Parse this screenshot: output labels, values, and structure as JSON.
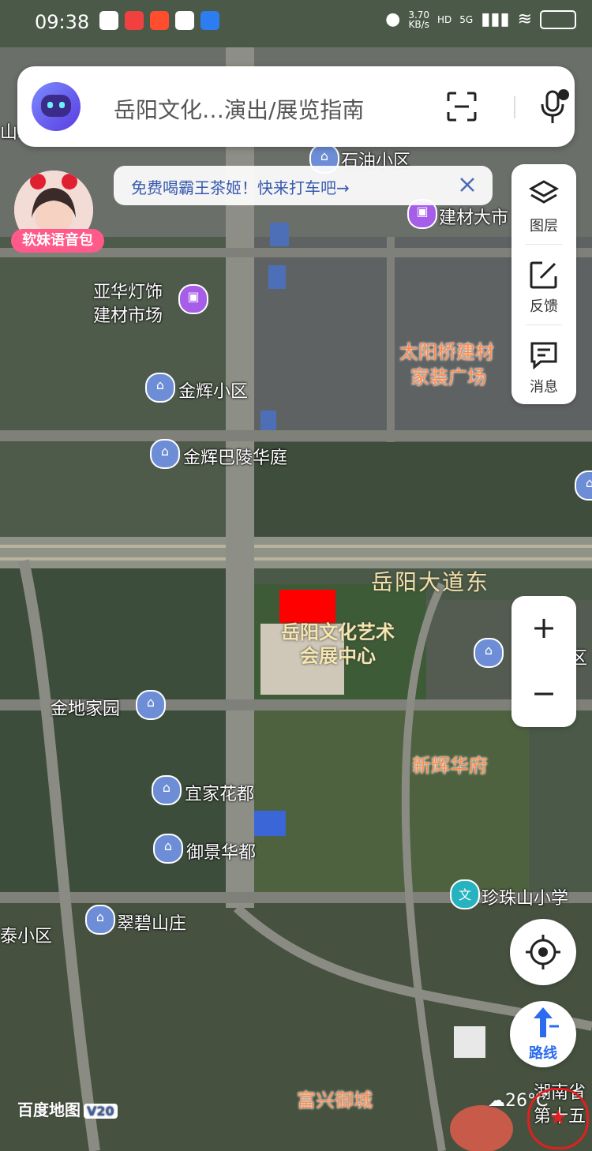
{
  "status_bar": {
    "time": "09:38",
    "network_speed_value": "3.70",
    "network_speed_unit": "KB/s",
    "hd_label": "HD",
    "signal_label": "5G"
  },
  "search": {
    "query_text": "岳阳文化…演出/展览指南"
  },
  "promo": {
    "text": "免费喝霸王茶姬！快来打车吧→"
  },
  "voice_pack": {
    "label": "软妹语音包"
  },
  "side_panel": {
    "layers_label": "图层",
    "feedback_label": "反馈",
    "messages_label": "消息"
  },
  "zoom": {
    "in_label": "+",
    "out_label": "−"
  },
  "route": {
    "label": "路线"
  },
  "map_labels": {
    "shiyou": "石油小区",
    "jiancai_top": "建材大市",
    "yahua_1": "亚华灯饰",
    "yahua_2": "建材市场",
    "taiyangqiao_1": "太阳桥建材",
    "taiyangqiao_2": "家装广场",
    "jinhui": "金辉小区",
    "jinhui_baling": "金辉巴陵华庭",
    "road_main": "岳阳大道东",
    "venue_1": "岳阳文化艺术",
    "venue_2": "会展中心",
    "jindi": "金地家园",
    "xinhui": "新辉华府",
    "yijia": "宜家花都",
    "yujing": "御景华都",
    "zhenzhushan": "珍珠山小学",
    "cuibi": "翠碧山庄",
    "left_xiaoqu": "泰小区",
    "fuxing": "富兴御城",
    "right_qu": "区",
    "hunan_1": "湖南省",
    "hunan_2": "第十五",
    "top_left": "山新"
  },
  "watermark": {
    "brand": "百度地图",
    "version": "V20"
  },
  "weather": {
    "temp": "26°C"
  },
  "colors": {
    "accent_blue": "#2a6bf0",
    "highlight_red": "#ff0000",
    "orange_label": "#ff8a4c"
  }
}
